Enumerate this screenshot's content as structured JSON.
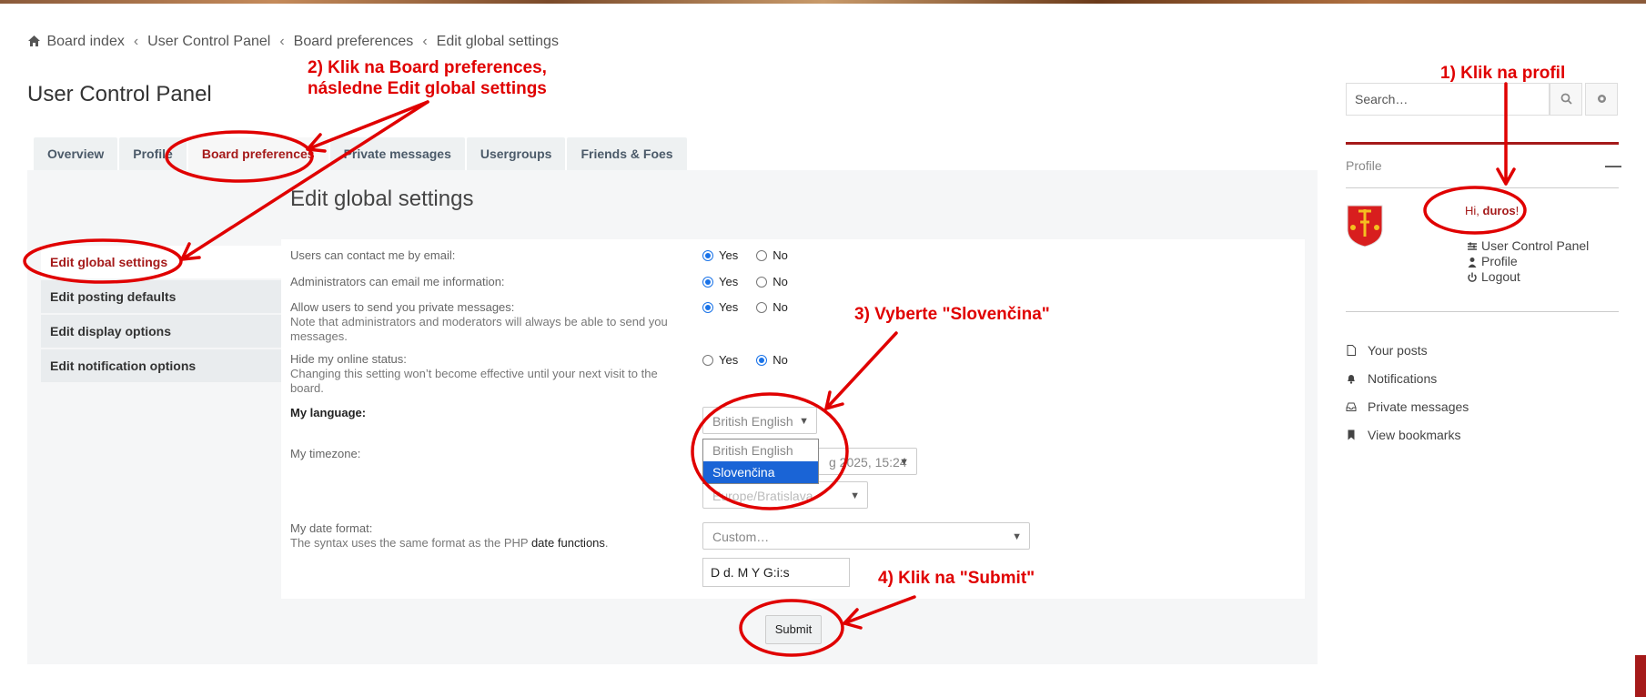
{
  "breadcrumb": {
    "items": [
      "Board index",
      "User Control Panel",
      "Board preferences",
      "Edit global settings"
    ],
    "separator": "‹"
  },
  "page": {
    "title": "User Control Panel"
  },
  "tabs": [
    {
      "label": "Overview"
    },
    {
      "label": "Profile"
    },
    {
      "label": "Board preferences",
      "active": true
    },
    {
      "label": "Private messages"
    },
    {
      "label": "Usergroups"
    },
    {
      "label": "Friends & Foes"
    }
  ],
  "sidemenu": [
    {
      "label": "Edit global settings",
      "active": true
    },
    {
      "label": "Edit posting defaults"
    },
    {
      "label": "Edit display options"
    },
    {
      "label": "Edit notification options"
    }
  ],
  "form": {
    "title": "Edit global settings",
    "yes": "Yes",
    "no": "No",
    "email_contact": {
      "label": "Users can contact me by email:",
      "value": "Yes"
    },
    "admin_email": {
      "label": "Administrators can email me information:",
      "value": "Yes"
    },
    "allow_pm": {
      "label": "Allow users to send you private messages:",
      "hint": "Note that administrators and moderators will always be able to send you messages.",
      "value": "Yes"
    },
    "hide_online": {
      "label": "Hide my online status:",
      "hint": "Changing this setting won’t become effective until your next visit to the board.",
      "value": "No"
    },
    "language": {
      "label": "My language:",
      "value": "British English",
      "options": [
        "British English",
        "Slovenčina"
      ],
      "highlighted": "Slovenčina"
    },
    "timezone": {
      "label": "My timezone:",
      "date_visible": "g 2025, 15:24",
      "zone_visible": "Europe/Bratislava"
    },
    "date_format": {
      "label": "My date format:",
      "hint_prefix": "The syntax uses the same format as the PHP",
      "hint_link": "date functions",
      "hint_suffix": ".",
      "select_value": "Custom…",
      "input_value": "D d. M Y G:i:s"
    },
    "submit_label": "Submit"
  },
  "sidebar": {
    "search_placeholder": "Search…",
    "profile_heading": "Profile",
    "greeting_prefix": "Hi,",
    "username": "duros",
    "greeting_suffix": "!",
    "user_links": [
      "User Control Panel",
      "Profile",
      "Logout"
    ],
    "quick_links": [
      "Your posts",
      "Notifications",
      "Private messages",
      "View bookmarks"
    ]
  },
  "annotations": {
    "a1": "1) Klik na profil",
    "a2_line1": "2) Klik na Board preferences,",
    "a2_line2": "následne Edit global settings",
    "a3": "3) Vyberte \"Slovenčina\"",
    "a4": "4) Klik na \"Submit\"",
    "color": "#e00000"
  },
  "colors": {
    "accent": "#a51a1a",
    "select_highlight": "#1a64d6",
    "radio": "#1a73e8"
  }
}
